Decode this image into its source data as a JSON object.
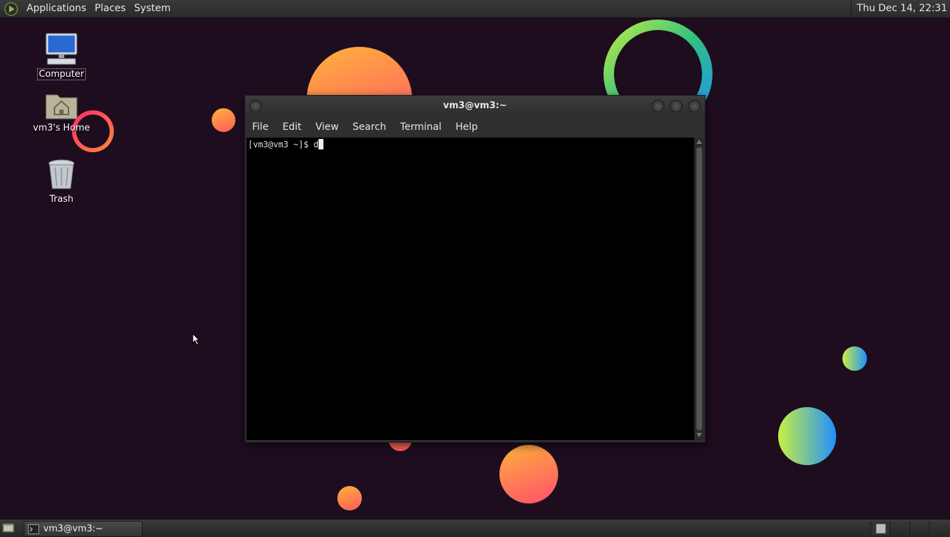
{
  "top_panel": {
    "menus": [
      "Applications",
      "Places",
      "System"
    ],
    "clock": "Thu Dec 14, 22:31"
  },
  "desktop": {
    "icons": [
      {
        "label": "Computer"
      },
      {
        "label": "vm3's Home"
      },
      {
        "label": "Trash"
      }
    ]
  },
  "terminal": {
    "title": "vm3@vm3:~",
    "menus": [
      "File",
      "Edit",
      "View",
      "Search",
      "Terminal",
      "Help"
    ],
    "prompt": "[vm3@vm3 ~]$ ",
    "input": "d"
  },
  "taskbar": {
    "task_label": "vm3@vm3:~"
  },
  "colors": {
    "desktop_bg": "#1e0d1f",
    "panel_bg": "#2e2e2e",
    "terminal_bg": "#000000"
  }
}
